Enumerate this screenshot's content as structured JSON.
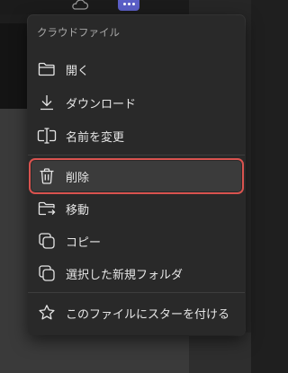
{
  "menu": {
    "header": "クラウドファイル",
    "items": [
      {
        "label": "開く",
        "icon": "folder-open-icon"
      },
      {
        "label": "ダウンロード",
        "icon": "download-icon"
      },
      {
        "label": "名前を変更",
        "icon": "rename-icon"
      },
      {
        "label": "削除",
        "icon": "trash-icon"
      },
      {
        "label": "移動",
        "icon": "folder-move-icon"
      },
      {
        "label": "コピー",
        "icon": "copy-icon"
      },
      {
        "label": "選択した新規フォルダ",
        "icon": "copy-icon"
      },
      {
        "label": "このファイルにスターを付ける",
        "icon": "star-icon"
      }
    ]
  },
  "colors": {
    "menu_bg": "#292929",
    "highlight_outline": "#d9534f",
    "accent": "#5b5fc7"
  }
}
